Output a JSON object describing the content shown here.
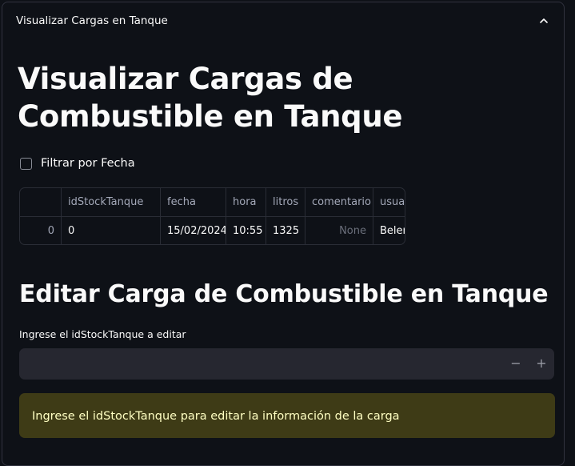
{
  "expander": {
    "label": "Visualizar Cargas en Tanque",
    "chevron_icon": "chevron-up-icon"
  },
  "page": {
    "title": "Visualizar Cargas de Combustible en Tanque"
  },
  "filter": {
    "checkbox_label": "Filtrar por Fecha",
    "checked": false
  },
  "table": {
    "columns": [
      "",
      "idStockTanque",
      "fecha",
      "hora",
      "litros",
      "comentario",
      "usuario"
    ],
    "rows": [
      {
        "index": "0",
        "idStockTanque": "0",
        "fecha": "15/02/2024",
        "hora": "10:55",
        "litros": "1325",
        "comentario": "None",
        "usuario": "Belen"
      }
    ]
  },
  "edit": {
    "title": "Editar Carga de Combustible en Tanque",
    "input_label": "Ingrese el idStockTanque a editar",
    "input_value": "",
    "minus_label": "−",
    "plus_label": "+",
    "warning": "Ingrese el idStockTanque para editar la información de la carga"
  },
  "colors": {
    "background": "#0e1117",
    "input_bg": "#262730",
    "warning_bg": "#3e3b16",
    "warning_text": "#ffffc2"
  }
}
